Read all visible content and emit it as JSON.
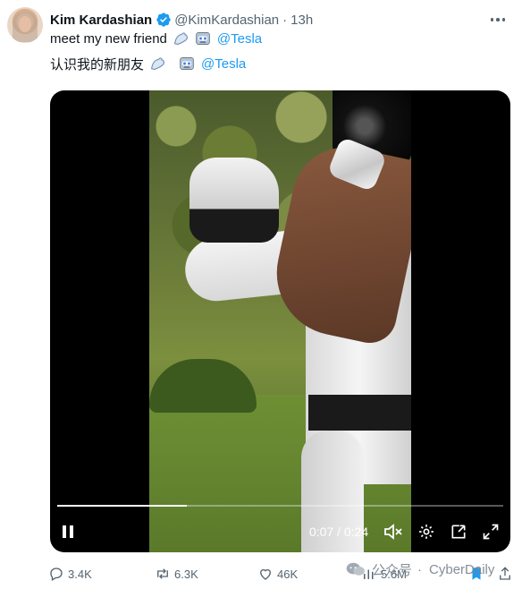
{
  "tweet": {
    "author_name": "Kim Kardashian",
    "author_handle": "@KimKardashian",
    "separator": "·",
    "time": "13h",
    "line1_text": "meet my new friend",
    "line1_mention": "@Tesla",
    "line2_text": "认识我的新朋友",
    "line2_mention": "@Tesla",
    "icons": [
      "verified-badge-icon",
      "flexed-biceps-emoji",
      "robot-emoji",
      "more-options-icon"
    ]
  },
  "video": {
    "progress_fraction": 0.29,
    "time_readout": "0:07 / 0:24",
    "controls": [
      "pause-icon",
      "mute-icon",
      "settings-icon",
      "picture-in-picture-icon",
      "fullscreen-icon"
    ]
  },
  "actions": {
    "replies": "3.4K",
    "reposts": "6.3K",
    "likes": "46K",
    "views": "5.6M"
  },
  "watermark": {
    "label": "公众号",
    "brand": "CyberDaily"
  },
  "colors": {
    "link": "#1d9bf0",
    "muted": "#536471",
    "verified": "#1d9bf0",
    "video_bg": "#000000"
  }
}
